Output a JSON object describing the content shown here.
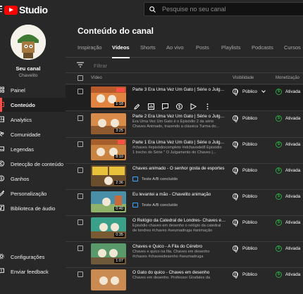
{
  "header": {
    "logo_text": "Studio",
    "search_placeholder": "Pesquise no seu canal"
  },
  "channel": {
    "label": "Seu canal",
    "name": "Chavelito"
  },
  "sidebar": {
    "items": [
      {
        "label": "Painel",
        "icon": "dashboard-icon"
      },
      {
        "label": "Conteúdo",
        "icon": "content-icon",
        "active": true
      },
      {
        "label": "Analytics",
        "icon": "analytics-icon"
      },
      {
        "label": "Comunidade",
        "icon": "community-icon"
      },
      {
        "label": "Legendas",
        "icon": "subtitles-icon"
      },
      {
        "label": "Detecção de conteúdo",
        "icon": "copyright-icon"
      },
      {
        "label": "Ganhos",
        "icon": "earn-icon"
      },
      {
        "label": "Personalização",
        "icon": "customization-icon"
      },
      {
        "label": "Biblioteca de áudio",
        "icon": "audio-library-icon"
      }
    ],
    "bottom": [
      {
        "label": "Configurações",
        "icon": "gear-icon"
      },
      {
        "label": "Enviar feedback",
        "icon": "feedback-icon"
      }
    ]
  },
  "main": {
    "title": "Conteúdo do canal",
    "tabs": [
      "Inspiração",
      "Vídeos",
      "Shorts",
      "Ao vivo",
      "Posts",
      "Playlists",
      "Podcasts",
      "Cursos"
    ],
    "active_tab": "Vídeos",
    "filter_placeholder": "Filtrar",
    "columns": {
      "video": "Vídeo",
      "visibility": "Visibilidade",
      "monetization": "Monetização"
    }
  },
  "videos": [
    {
      "title": "Parte 3 Era Uma Vez Um Gato | Série o Julgame...",
      "desc": "",
      "duration": "1:18",
      "visibility": "Público",
      "monetization": "Ativada",
      "hover": true,
      "thumb": "#d97a3a"
    },
    {
      "title": "Parte 2 Era Uma Vez Um Gato | Série o Julgame...",
      "desc": "Era Uma Vez Um Gato é o Episódio 2 da série Chaves Animado, trazendo a clássica Turma do...",
      "duration": "3:25",
      "visibility": "Público",
      "monetization": "Ativada",
      "thumb": "#d98b4a"
    },
    {
      "title": "Parte 1 Era Uma Vez Um Gato | Série o Julgame...",
      "desc": "#chaves #episódiocompleto #elchavodel8 Episódio 1 trecho do Série \" O Julgamento do Chaves |...",
      "duration": "8:10",
      "visibility": "Público",
      "monetization": "Ativada",
      "thumb": "#c98442"
    },
    {
      "title": "Chaves animado - O senhor gosta de esportes",
      "desc": "",
      "ab": "Teste A/B concluído",
      "duration": "2:36",
      "visibility": "Público",
      "monetization": "Ativada",
      "thumb": "#7a5a32"
    },
    {
      "title": "Eu levantei a mão - Chavelito animação",
      "desc": "",
      "ab": "Teste A/B concluído",
      "duration": "0:40",
      "visibility": "Público",
      "monetization": "Ativada",
      "thumb": "#4a8fa8"
    },
    {
      "title": "O Relógio da Catedral de Londres- Chaves e se...",
      "desc": "Episódio chaves em desenho o relógio da catedral de londres #chaves #seumadruga #animação",
      "duration": "0:35",
      "visibility": "Público",
      "monetization": "Ativada",
      "thumb": "#3aa08a"
    },
    {
      "title": "Chaves e Quico - A Fila do Cérebro",
      "desc": "Chaves e quico na fila. Chaves em desenho #chaves #chavesdesenho #seumadruga",
      "duration": "1:07",
      "visibility": "Público",
      "monetization": "Ativada",
      "thumb": "#5a9a6a"
    },
    {
      "title": "O Gato do quico - Chaves em desenho",
      "desc": "Chaves em desenho. Professor Girafales da",
      "duration": "",
      "visibility": "Público",
      "monetization": "Ativada",
      "thumb": "#c98b52"
    }
  ],
  "colors": {
    "accent": "#ff4e45",
    "brand": "#ff0000",
    "monetized": "#2ba640",
    "background": "#282828",
    "active_bg": "#1f1f1f"
  }
}
